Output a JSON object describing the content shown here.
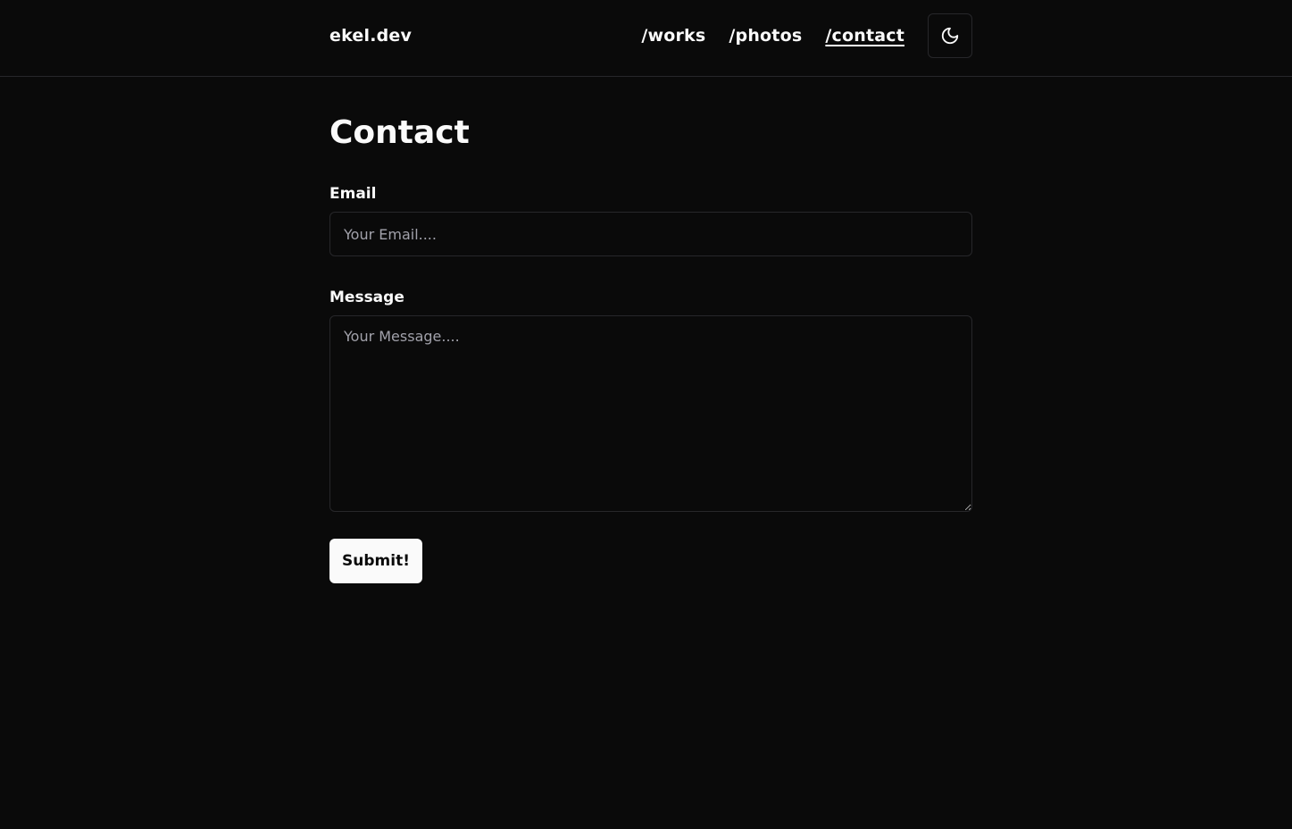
{
  "header": {
    "brand": "ekel.dev",
    "nav": [
      {
        "label": "/works",
        "active": false
      },
      {
        "label": "/photos",
        "active": false
      },
      {
        "label": "/contact",
        "active": true
      }
    ],
    "theme_toggle_icon": "moon-icon"
  },
  "main": {
    "title": "Contact",
    "email": {
      "label": "Email",
      "placeholder": "Your Email....",
      "value": ""
    },
    "message": {
      "label": "Message",
      "placeholder": "Your Message....",
      "value": ""
    },
    "submit_label": "Submit!"
  },
  "colors": {
    "background": "#0a0a0a",
    "foreground": "#fafafa",
    "border": "#27272a",
    "placeholder": "#a1a1aa"
  }
}
